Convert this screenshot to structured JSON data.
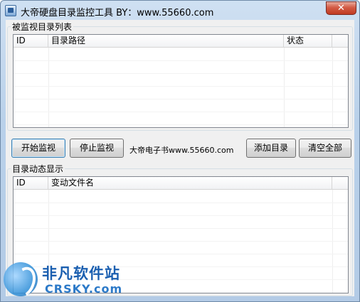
{
  "window": {
    "title": "大帝硬盘目录监控工具 BY：www.55660.com",
    "close_symbol": "✕"
  },
  "monitored_group": {
    "title": "被监视目录列表",
    "columns": [
      "ID",
      "目录路径",
      "状态"
    ],
    "rows": []
  },
  "toolbar": {
    "start_label": "开始监视",
    "stop_label": "停止监视",
    "info_text": "大帝电子书www.55660.com",
    "add_label": "添加目录",
    "clear_label": "清空全部"
  },
  "dynamic_group": {
    "title": "目录动态显示",
    "columns": [
      "ID",
      "变动文件名"
    ],
    "rows": []
  },
  "watermark": {
    "cn": "非凡软件站",
    "en": "CRSKY.com"
  }
}
